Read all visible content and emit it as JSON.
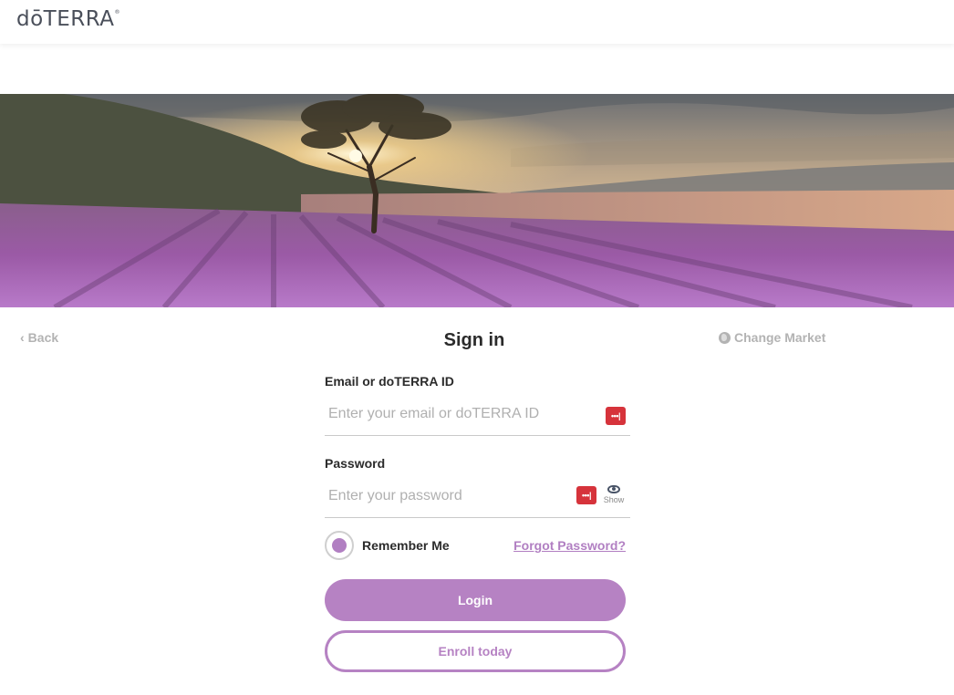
{
  "brand": {
    "logo_text": "dōTERRA",
    "logo_mark": "®"
  },
  "nav": {
    "back_label": "Back",
    "title": "Sign in",
    "change_market_label": "Change Market"
  },
  "form": {
    "email": {
      "label": "Email or doTERRA ID",
      "placeholder": "Enter your email or doTERRA ID",
      "value": ""
    },
    "password": {
      "label": "Password",
      "placeholder": "Enter your password",
      "value": "",
      "show_label": "Show"
    },
    "remember_label": "Remember Me",
    "remember_checked": true,
    "forgot_label": "Forgot Password?",
    "login_label": "Login",
    "enroll_label": "Enroll today",
    "password_manager_icon_text": "•••|"
  },
  "colors": {
    "accent": "#b682c3",
    "password_manager": "#d6333b",
    "muted_text": "#b3b3b3"
  },
  "icons": [
    "chevron-left-icon",
    "globe-icon",
    "password-manager-icon",
    "eye-icon"
  ]
}
